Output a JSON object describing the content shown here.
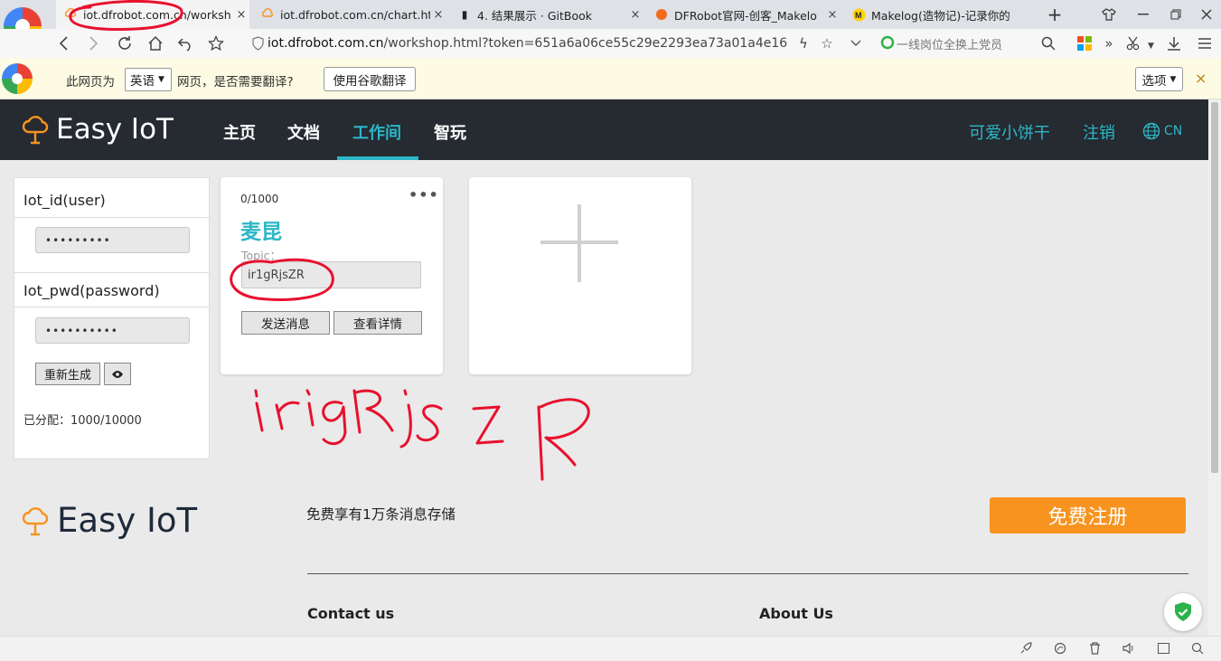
{
  "browser": {
    "tabs": [
      {
        "label": "iot.dfrobot.com.cn/worksh"
      },
      {
        "label": "iot.dfrobot.com.cn/chart.ht"
      },
      {
        "label": "4. 结果展示 · GitBook"
      },
      {
        "label": "DFRobot官网-创客_Makelo"
      },
      {
        "label": "Makelog(造物记)-记录你的"
      }
    ],
    "new_tab": "+",
    "close_glyph": "×",
    "url_host": "iot.dfrobot.com.cn",
    "url_rest": "/workshop.html?token=651a6a06ce55c29e2293ea73a01a4e16",
    "search_placeholder": "一线岗位全换上党员"
  },
  "translate_bar": {
    "ask": "此网页为",
    "language": "英语",
    "question": "网页，是否需要翻译?",
    "translate_button": "使用谷歌翻译",
    "options": "选项",
    "close": "×"
  },
  "site": {
    "logo_text": "Easy IoT",
    "nav": [
      {
        "label": "主页"
      },
      {
        "label": "文档"
      },
      {
        "label": "工作间"
      },
      {
        "label": "智玩"
      }
    ],
    "username": "可爱小饼干",
    "logout": "注销",
    "lang": "CN"
  },
  "credentials": {
    "id_label": "Iot_id(user)",
    "id_value": "•••••••••",
    "pwd_label": "Iot_pwd(password)",
    "pwd_value": "••••••••••",
    "regenerate": "重新生成",
    "assigned": "已分配：1000/10000"
  },
  "device": {
    "count": "0/1000",
    "menu": "•••",
    "name": "麦昆",
    "topic_label": "Topic：",
    "topic_value": "ir1gRjsZR",
    "send": "发送消息",
    "details": "查看详情"
  },
  "add_device": "+",
  "footer": {
    "logo_text": "Easy IoT",
    "storage": "免费享有1万条消息存储",
    "register": "免费注册",
    "contact": "Contact us",
    "about": "About Us"
  },
  "annotation": {
    "handwriting": "irigRjsZR",
    "ink_color": "#e8112d"
  },
  "colors": {
    "accent": "#2bb7c7",
    "header": "#262a31",
    "register": "#f7931e"
  }
}
